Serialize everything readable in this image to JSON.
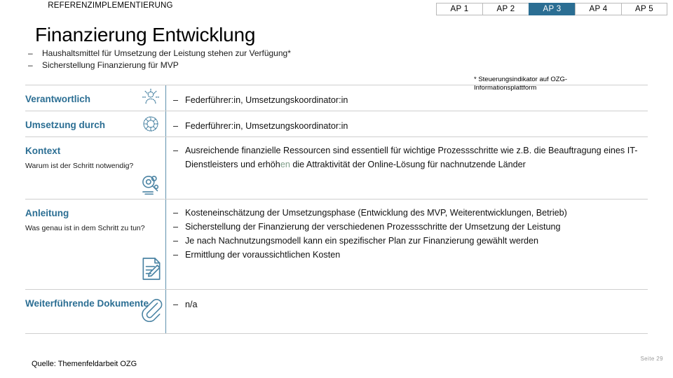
{
  "header": {
    "eyebrow": "REFERENZIMPLEMENTIERUNG",
    "title": "Finanzierung Entwicklung",
    "subtitle_bullets": [
      "Haushaltsmittel für Umsetzung der Leistung stehen zur Verfügung*",
      "Sicherstellung Finanzierung für MVP"
    ],
    "dash": "–"
  },
  "tabs": {
    "active_index": 2,
    "items": [
      {
        "prefix": "AP",
        "number": "1",
        "label": "AP 1",
        "active": false
      },
      {
        "prefix": "AP",
        "number": "2",
        "label": "AP 2",
        "active": false
      },
      {
        "prefix": "AP",
        "number": "3",
        "label": "AP 3",
        "active": true
      },
      {
        "prefix": "AP",
        "number": "4",
        "label": "AP 4",
        "active": false
      },
      {
        "prefix": "AP",
        "number": "5",
        "label": "AP 5",
        "active": false
      }
    ]
  },
  "footnote": {
    "line1": "* Steuerungsindikator auf OZG-",
    "line2": "Informationsplattform"
  },
  "rows": [
    {
      "label": "Verantwortlich",
      "sublabel": "",
      "icon": "person-network-icon",
      "bullets": [
        {
          "dash": "–",
          "pre": "Federführer:in, Umsetzungskoordinator:in",
          "edited": "",
          "post": ""
        }
      ]
    },
    {
      "label": "Umsetzung durch",
      "sublabel": "",
      "icon": "lifebuoy-gear-icon",
      "bullets": [
        {
          "dash": "–",
          "pre": "Federführer:in, Umsetzungskoordinator:in",
          "edited": "",
          "post": ""
        }
      ]
    },
    {
      "label": "Kontext",
      "sublabel": "Warum ist der Schritt notwendig?",
      "icon": "magnifier-search-icon",
      "bullets": [
        {
          "dash": "–",
          "pre": "Ausreichende finanzielle Ressourcen sind essentiell für wichtige Prozessschritte wie z.B. die Beauftragung eines IT-Dienstleisters und erhöh",
          "edited": "en",
          "post": " die Attraktivität der Online-Lösung für nachnutzende Länder"
        }
      ]
    },
    {
      "label": "Anleitung",
      "sublabel": "Was genau ist in dem Schritt zu tun?",
      "icon": "document-pencil-icon",
      "bullets": [
        {
          "dash": "–",
          "pre": "Kosteneinschätzung der Umsetzungsphase (Entwicklung des MVP, Weiterentwicklungen, Betrieb)",
          "edited": "",
          "post": ""
        },
        {
          "dash": "–",
          "pre": "Sicherstellung der Finanzierung der verschiedenen Prozessschritte der Umsetzung der Leistung",
          "edited": "",
          "post": ""
        },
        {
          "dash": "–",
          "pre": "Je nach Nachnutzungsmodell kann ein spezifischer Plan zur Finanzierung gewählt werden",
          "edited": "",
          "post": ""
        },
        {
          "dash": "–",
          "pre": "Ermittlung der voraussichtlichen Kosten",
          "edited": "",
          "post": ""
        }
      ]
    },
    {
      "label": "Weiterführende Dokumente",
      "sublabel": "",
      "icon": "paperclip-icon",
      "bullets": [
        {
          "dash": "–",
          "pre": "n/a",
          "edited": "",
          "post": ""
        }
      ]
    }
  ],
  "footer": {
    "source": "Quelle: Themenfeldarbeit OZG",
    "page": "Seite 29"
  },
  "colors": {
    "accent": "#2b6e93",
    "edited_text": "#7e9d88",
    "divider": "#cfcfcf"
  }
}
